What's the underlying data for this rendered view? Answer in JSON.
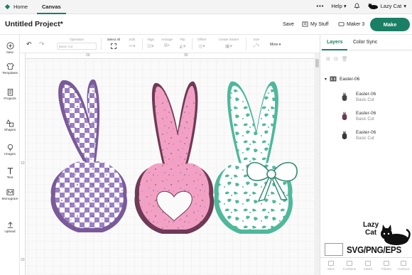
{
  "topbar": {
    "home_label": "Home",
    "canvas_label": "Canvas",
    "menu_dots": "•••",
    "help_label": "Help",
    "user_name": "Lazy Cat"
  },
  "project": {
    "title": "Untitled Project*",
    "save_label": "Save",
    "mystuff_label": "My Stuff",
    "machine_label": "Maker 3",
    "make_label": "Make"
  },
  "toolbar": {
    "operation_label": "Operation",
    "operation_value": "Basic Cut",
    "select_all_label": "Select All",
    "edit_label": "Edit",
    "align_label": "Align",
    "arrange_label": "Arrange",
    "flip_label": "Flip",
    "offset_label": "Offset",
    "warp_label": "Create Sticker",
    "size_label": "Size",
    "more_label": "More ▾"
  },
  "sidebar": {
    "items": [
      {
        "label": "New",
        "icon": "plus-icon"
      },
      {
        "label": "Templates",
        "icon": "shirt-icon"
      },
      {
        "label": "Projects",
        "icon": "clipboard-icon"
      },
      {
        "label": "Shapes",
        "icon": "shapes-icon"
      },
      {
        "label": "Images",
        "icon": "bulb-icon"
      },
      {
        "label": "Text",
        "icon": "text-icon"
      },
      {
        "label": "Monogram",
        "icon": "monogram-icon"
      },
      {
        "label": "Upload",
        "icon": "upload-icon"
      }
    ]
  },
  "rulers": {
    "top": [
      "20",
      "30"
    ],
    "left": [
      "10",
      "20"
    ]
  },
  "panel": {
    "tabs": [
      "Layers",
      "Color Sync"
    ],
    "group_name": "Easter-06",
    "layers": [
      {
        "name": "Easter-06",
        "operation": "Basic Cut"
      },
      {
        "name": "Easter-06",
        "operation": "Basic Cut"
      },
      {
        "name": "Easter-06",
        "operation": "Basic Cut"
      }
    ],
    "actions": [
      "Slice",
      "Combine",
      "Attach",
      "Flatten",
      "Contour"
    ]
  },
  "watermark": {
    "logo_text_1": "Lazy",
    "logo_text_2": "Cat",
    "formats": "SVG/PNG/EPS"
  },
  "colors": {
    "accent": "#1a7f64",
    "bunny_purple": "#9b7fc4",
    "bunny_pink": "#f2a1c4",
    "bunny_teal": "#4fb89b"
  }
}
